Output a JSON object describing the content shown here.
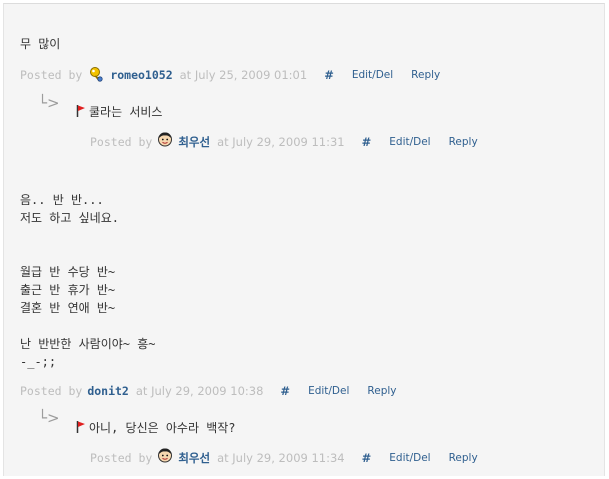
{
  "comments": [
    {
      "body_lines": [
        "무 많이"
      ],
      "posted_by": "Posted by",
      "author": "romeo1052",
      "at_text": "at July 25, 2009 01:01",
      "hash": "#",
      "edit_label": "Edit/Del",
      "reply_label": "Reply",
      "reply": {
        "arrow": "└>",
        "text": "쿨라는 서비스",
        "posted_by": "Posted by",
        "author": "최우선",
        "at_text": "at July 29, 2009 11:31",
        "hash": "#",
        "edit_label": "Edit/Del",
        "reply_label": "Reply"
      }
    },
    {
      "body_lines": [
        "음.. 반 반...",
        "저도 하고 싶네요.",
        "",
        "",
        "월급 반 수당 반~",
        "출근 반 휴가 반~",
        "결혼 반 연애 반~",
        "",
        "난 반반한 사람이야~ 흥~",
        "-_-;;"
      ],
      "posted_by": "Posted by",
      "author": "donit2",
      "at_text": "at July 29, 2009 10:38",
      "hash": "#",
      "edit_label": "Edit/Del",
      "reply_label": "Reply",
      "reply": {
        "arrow": "└>",
        "text": "아니, 당신은 아수라 백작?",
        "posted_by": "Posted by",
        "author": "최우선",
        "at_text": "at July 29, 2009 11:34",
        "hash": "#",
        "edit_label": "Edit/Del",
        "reply_label": "Reply"
      }
    }
  ],
  "colors": {
    "background": "#f5f5f5",
    "link": "#2f5f8f",
    "meta": "#bdbdbd",
    "body_text": "#333333"
  },
  "icons": {
    "user_romeo": "pin-avatar-icon",
    "user_choi": "face-avatar-icon",
    "reply_flag": "red-flag-icon",
    "reply_arrow": "reply-arrow-icon"
  }
}
